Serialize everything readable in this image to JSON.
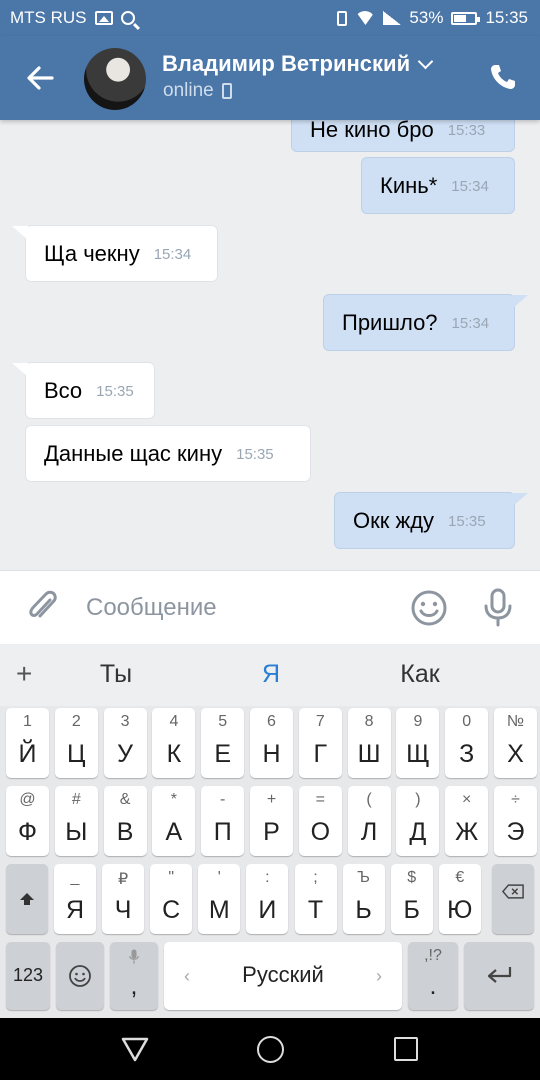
{
  "status_bar": {
    "carrier": "MTS RUS",
    "battery": "53%",
    "time": "15:35"
  },
  "header": {
    "name": "Владимир Ветринский",
    "status": "online"
  },
  "messages": [
    {
      "text": "Не кино бро",
      "time": "15:33",
      "dir": "out"
    },
    {
      "text": "Кинь*",
      "time": "15:34",
      "dir": "out"
    },
    {
      "text": "Ща чекну",
      "time": "15:34",
      "dir": "in"
    },
    {
      "text": "Пришло?",
      "time": "15:34",
      "dir": "out"
    },
    {
      "text": "Всо",
      "time": "15:35",
      "dir": "in"
    },
    {
      "text": "Данные щас кину",
      "time": "15:35",
      "dir": "in"
    },
    {
      "text": "Окк жду",
      "time": "15:35",
      "dir": "out"
    }
  ],
  "compose": {
    "placeholder": "Сообщение"
  },
  "keyboard": {
    "suggestions": [
      "Ты",
      "Я",
      "Как"
    ],
    "plus": "+",
    "row1": [
      [
        "1",
        "Й"
      ],
      [
        "2",
        "Ц"
      ],
      [
        "3",
        "У"
      ],
      [
        "4",
        "К"
      ],
      [
        "5",
        "Е"
      ],
      [
        "6",
        "Н"
      ],
      [
        "7",
        "Г"
      ],
      [
        "8",
        "Ш"
      ],
      [
        "9",
        "Щ"
      ],
      [
        "0",
        "З"
      ],
      [
        "№",
        "Х"
      ]
    ],
    "row2": [
      [
        "@",
        "Ф"
      ],
      [
        "#",
        "Ы"
      ],
      [
        "&",
        "В"
      ],
      [
        "*",
        "А"
      ],
      [
        "-",
        "П"
      ],
      [
        "+",
        "Р"
      ],
      [
        "=",
        "О"
      ],
      [
        "(",
        "Л"
      ],
      [
        ")",
        "Д"
      ],
      [
        "×",
        "Ж"
      ],
      [
        "÷",
        "Э"
      ]
    ],
    "row3": [
      [
        "_",
        "Я"
      ],
      [
        "₽",
        "Ч"
      ],
      [
        "\"",
        "С"
      ],
      [
        "'",
        "М"
      ],
      [
        ":",
        "И"
      ],
      [
        ";",
        "Т"
      ],
      [
        "Ъ",
        "Ь"
      ],
      [
        "$",
        "Б"
      ],
      [
        "€",
        "Ю"
      ]
    ],
    "row4": {
      "numbers": "123",
      "comma": ",",
      "space": "Русский",
      "period": ".",
      "period_hint": ",!?"
    }
  }
}
